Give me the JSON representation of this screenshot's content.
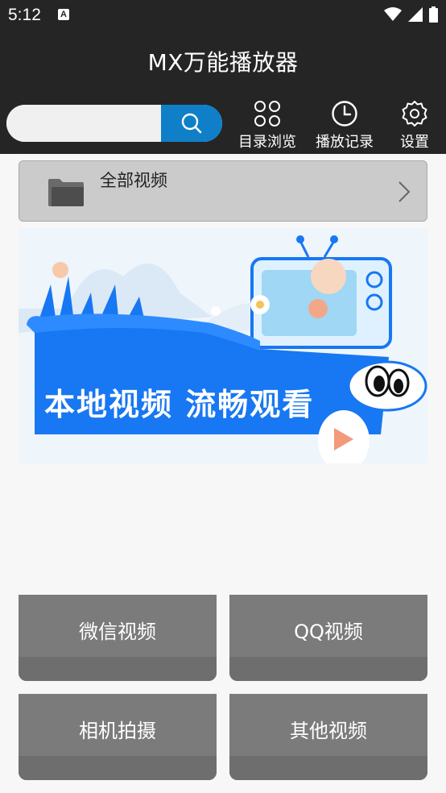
{
  "status": {
    "time": "5:12",
    "notification_icon": "A"
  },
  "app": {
    "title": "MX万能播放器"
  },
  "search": {
    "placeholder": "",
    "value": ""
  },
  "toolbar": [
    {
      "label": "目录浏览",
      "icon": "grid-icon"
    },
    {
      "label": "播放记录",
      "icon": "clock-icon"
    },
    {
      "label": "设置",
      "icon": "gear-icon"
    }
  ],
  "all_videos": {
    "label": "全部视频",
    "icon": "folder-icon"
  },
  "banner": {
    "text": "本地视频 流畅观看"
  },
  "categories": [
    {
      "label": "微信视频"
    },
    {
      "label": "QQ视频"
    },
    {
      "label": "相机拍摄"
    },
    {
      "label": "其他视频"
    }
  ],
  "colors": {
    "bar": "#252525",
    "search_button": "#0f80c8",
    "tile": "#7b7b7b",
    "banner_blue": "#1877f2"
  }
}
